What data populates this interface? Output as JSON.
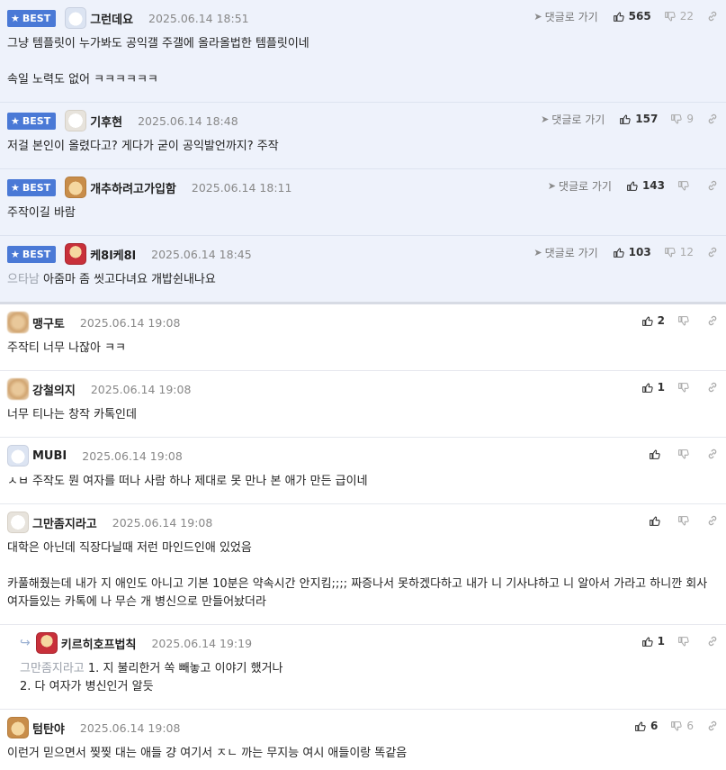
{
  "common": {
    "best_label": "BEST",
    "reply_label": "댓글로 가기"
  },
  "comments": [
    {
      "nick": "그런데요",
      "date": "2025.06.14 18:51",
      "up": "565",
      "down": "22",
      "mention": "",
      "body": "그냥 템플릿이 누가봐도 공익갤 주갤에 올라올법한 템플릿이네\n\n속일 노력도 없어 ㅋㅋㅋㅋㅋㅋ"
    },
    {
      "nick": "기후현",
      "date": "2025.06.14 18:48",
      "up": "157",
      "down": "9",
      "mention": "",
      "body": "저걸 본인이 올렸다고? 게다가 굳이 공익발언까지? 주작"
    },
    {
      "nick": "개추하려고가입함",
      "date": "2025.06.14 18:11",
      "up": "143",
      "down": "",
      "mention": "",
      "body": "주작이길 바람"
    },
    {
      "nick": "케8l케8l",
      "date": "2025.06.14 18:45",
      "up": "103",
      "down": "12",
      "mention": "으타남",
      "body": "아줌마 좀 씻고다녀요 개밥쉰내나요"
    },
    {
      "nick": "맹구토",
      "date": "2025.06.14 19:08",
      "up": "2",
      "down": "",
      "mention": "",
      "body": "주작티 너무 나잖아 ㅋㅋ"
    },
    {
      "nick": "강철의지",
      "date": "2025.06.14 19:08",
      "up": "1",
      "down": "",
      "mention": "",
      "body": "너무 티나는 창작 카톡인데"
    },
    {
      "nick": "MUBI",
      "date": "2025.06.14 19:08",
      "up": "",
      "down": "",
      "mention": "",
      "body": "ㅅㅂ 주작도 뭔 여자를 떠나 사람 하나 제대로 못 만나 본 애가 만든 급이네"
    },
    {
      "nick": "그만좀지라고",
      "date": "2025.06.14 19:08",
      "up": "",
      "down": "",
      "mention": "",
      "body": "대학은 아닌데 직장다닐때 저런 마인드인애 있었음\n\n카풀해줬는데 내가 지 애인도 아니고 기본 10분은 약속시간 안지킴;;;; 짜증나서 못하겠다하고 내가 니 기사냐하고 니 알아서 가라고 하니깐 회사 여자들있는 카톡에 나 무슨 개 병신으로 만들어놨더라"
    },
    {
      "nick": "키르히호프법칙",
      "date": "2025.06.14 19:19",
      "up": "1",
      "down": "",
      "mention": "그만좀지라고",
      "body": "1. 지 불리한거 쏙 빼놓고 이야기 했거나\n2. 다 여자가 병신인거 알듯"
    },
    {
      "nick": "텀탄야",
      "date": "2025.06.14 19:08",
      "up": "6",
      "down": "6",
      "mention": "",
      "body": "이런거 믿으면서 찢찢 대는 애들 걍 여기서 ㅈㄴ 까는 무지능 여시 애들이랑 똑같음"
    }
  ]
}
